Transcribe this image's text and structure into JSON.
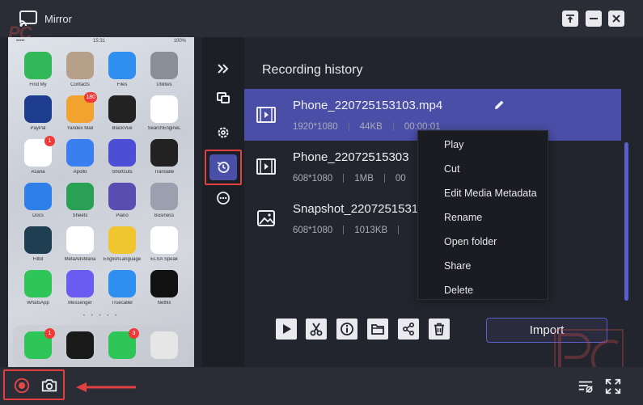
{
  "window": {
    "title": "Mirror",
    "watermark": "PC"
  },
  "phone": {
    "status_left": "••••• ",
    "status_time": "15:31",
    "status_right": "100%",
    "apps": [
      {
        "label": "Find My",
        "color": "#31b858",
        "badge": ""
      },
      {
        "label": "Contacts",
        "color": "#b7a08a",
        "badge": ""
      },
      {
        "label": "Files",
        "color": "#2f8ff0",
        "badge": ""
      },
      {
        "label": "Utilities",
        "color": "#8a8e99",
        "badge": ""
      },
      {
        "label": "PayPal",
        "color": "#1e3d8f",
        "badge": ""
      },
      {
        "label": "Yandex Mail",
        "color": "#f2a22e",
        "badge": "180"
      },
      {
        "label": "BlackVue",
        "color": "#222222",
        "badge": ""
      },
      {
        "label": "SearchEngineL",
        "color": "#ffffff",
        "badge": ""
      },
      {
        "label": "Asana",
        "color": "#ffffff",
        "badge": "1"
      },
      {
        "label": "Apollo",
        "color": "#3a7ff0",
        "badge": ""
      },
      {
        "label": "Shortcuts",
        "color": "#4c4fd6",
        "badge": ""
      },
      {
        "label": "Translate",
        "color": "#222222",
        "badge": ""
      },
      {
        "label": "Docs",
        "color": "#2f7fe8",
        "badge": ""
      },
      {
        "label": "Sheets",
        "color": "#2aa055",
        "badge": ""
      },
      {
        "label": "Piano",
        "color": "#5a4cb0",
        "badge": ""
      },
      {
        "label": "Business",
        "color": "#9aa0ad",
        "badge": ""
      },
      {
        "label": "Fitbit",
        "color": "#1f3e52",
        "badge": ""
      },
      {
        "label": "MetaAdsMana",
        "color": "#ffffff",
        "badge": ""
      },
      {
        "label": "EnglishLanguage",
        "color": "#f0c52e",
        "badge": ""
      },
      {
        "label": "ELSA Speak",
        "color": "#ffffff",
        "badge": ""
      },
      {
        "label": "WhatsApp",
        "color": "#2ec658",
        "badge": ""
      },
      {
        "label": "Messenger",
        "color": "#6a5cf0",
        "badge": ""
      },
      {
        "label": "Truecaller",
        "color": "#2f8ff0",
        "badge": ""
      },
      {
        "label": "Netflix",
        "color": "#111111",
        "badge": ""
      }
    ],
    "dock": [
      {
        "label": "",
        "color": "#2ec658",
        "badge": "1"
      },
      {
        "label": "",
        "color": "#1a1a1a",
        "badge": ""
      },
      {
        "label": "",
        "color": "#2ec658",
        "badge": "3"
      },
      {
        "label": "",
        "color": "#e6e6e6",
        "badge": ""
      }
    ]
  },
  "panel": {
    "title": "Recording history",
    "items": [
      {
        "name": "Phone_220725153103.mp4",
        "resolution": "1920*1080",
        "size": "44KB",
        "duration": "00:00:01",
        "type": "video"
      },
      {
        "name": "Phone_22072515303",
        "resolution": "608*1080",
        "size": "1MB",
        "duration": "00",
        "type": "video"
      },
      {
        "name": "Snapshot_2207251531",
        "resolution": "608*1080",
        "size": "1013KB",
        "duration": "",
        "type": "image"
      }
    ],
    "context_menu": [
      "Play",
      "Cut",
      "Edit Media Metadata",
      "Rename",
      "Open folder",
      "Share",
      "Delete"
    ],
    "import_label": "Import"
  },
  "colors": {
    "accent": "#4a4ea6",
    "highlight": "#e04040"
  }
}
